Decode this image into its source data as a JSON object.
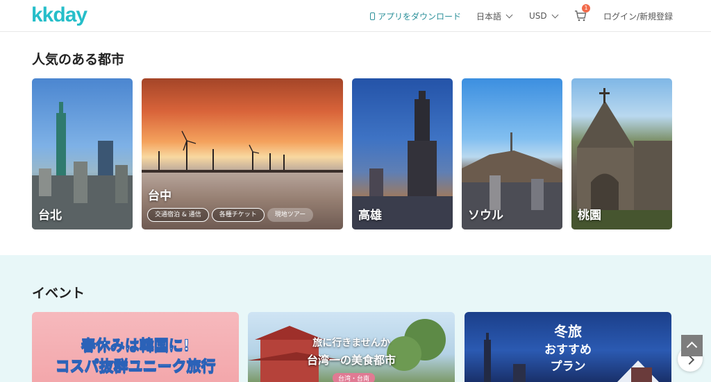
{
  "header": {
    "logo": "kkday",
    "app_download": "アプリをダウンロード",
    "language": "日本語",
    "currency": "USD",
    "cart_count": "1",
    "login": "ログイン/新規登録"
  },
  "cities": {
    "title": "人気のある都市",
    "items": [
      {
        "name": "台北"
      },
      {
        "name": "台中",
        "tags": [
          "交通宿泊 & 通信",
          "各種チケット",
          "現地ツアー"
        ]
      },
      {
        "name": "高雄"
      },
      {
        "name": "ソウル"
      },
      {
        "name": "桃園"
      }
    ]
  },
  "events": {
    "title": "イベント",
    "items": [
      {
        "line1": "春休みは韓国に!",
        "line2": "コスパ抜群ユニーク旅行"
      },
      {
        "line1": "旅に行きませんか",
        "line2": "台湾一の美食都市",
        "location": "台湾・台南"
      },
      {
        "line1": "冬旅",
        "line2": "おすすめ",
        "line3": "プラン"
      }
    ]
  },
  "colors": {
    "brand": "#26bec9",
    "events_bg": "#e8f7f8",
    "badge": "#f26b4b"
  }
}
